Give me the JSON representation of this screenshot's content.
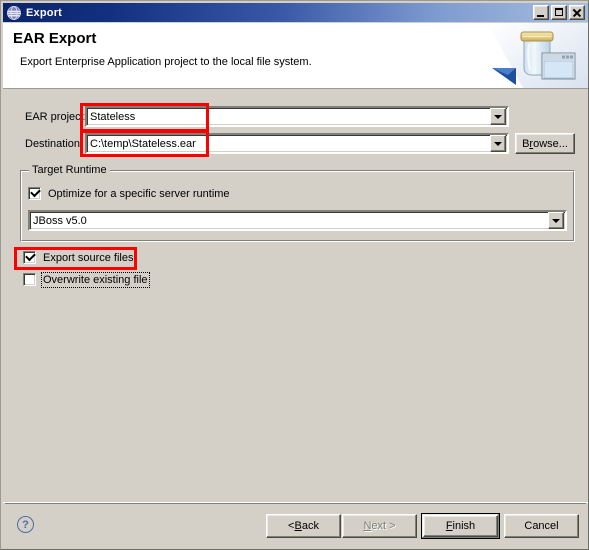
{
  "window": {
    "title": "Export",
    "icon": "eclipse-logo-icon",
    "controls": {
      "minimize": "minimize-icon",
      "maximize": "maximize-icon",
      "close": "close-icon"
    }
  },
  "header": {
    "title": "EAR Export",
    "description": "Export Enterprise Application project to the local file system.",
    "art_icon": "ear-export-jar-icon"
  },
  "form": {
    "ear_project": {
      "label": "EAR project:",
      "value": "Stateless",
      "arrow_icon": "chevron-down-icon"
    },
    "destination": {
      "label": "Destination",
      "value": "C:\\temp\\Stateless.ear",
      "arrow_icon": "chevron-down-icon"
    },
    "browse_button": {
      "prefix": "B",
      "mnemonic": "r",
      "suffix": "owse..."
    },
    "target_runtime": {
      "legend": "Target Runtime",
      "optimize_checkbox": {
        "label": "Optimize for a specific server runtime",
        "checked": true
      },
      "runtime_combo": {
        "value": "JBoss v5.0",
        "arrow_icon": "chevron-down-icon"
      }
    },
    "export_source_files": {
      "label": "Export source files",
      "checked": true
    },
    "overwrite_existing_file": {
      "label": "Overwrite existing file",
      "checked": false
    }
  },
  "footer": {
    "help_icon": "help-question-icon",
    "help_glyph": "?",
    "buttons": {
      "back": {
        "prefix": "< ",
        "mnemonic": "B",
        "suffix": "ack"
      },
      "next": {
        "prefix": "",
        "mnemonic": "N",
        "suffix": "ext >",
        "disabled": true
      },
      "finish": {
        "prefix": "",
        "mnemonic": "F",
        "suffix": "inish",
        "default": true
      },
      "cancel": {
        "label": "Cancel"
      }
    }
  },
  "annotations": {
    "highlight_color": "#ff0000",
    "boxes": [
      {
        "name": "ear-project-field-highlight"
      },
      {
        "name": "destination-field-highlight"
      },
      {
        "name": "export-source-files-highlight"
      }
    ]
  },
  "colors": {
    "dialog_background": "#d4d0c8",
    "titlebar_start": "#0a246a",
    "titlebar_end": "#a8bee0",
    "field_background": "#ffffff",
    "highlight": "#ff0000"
  }
}
